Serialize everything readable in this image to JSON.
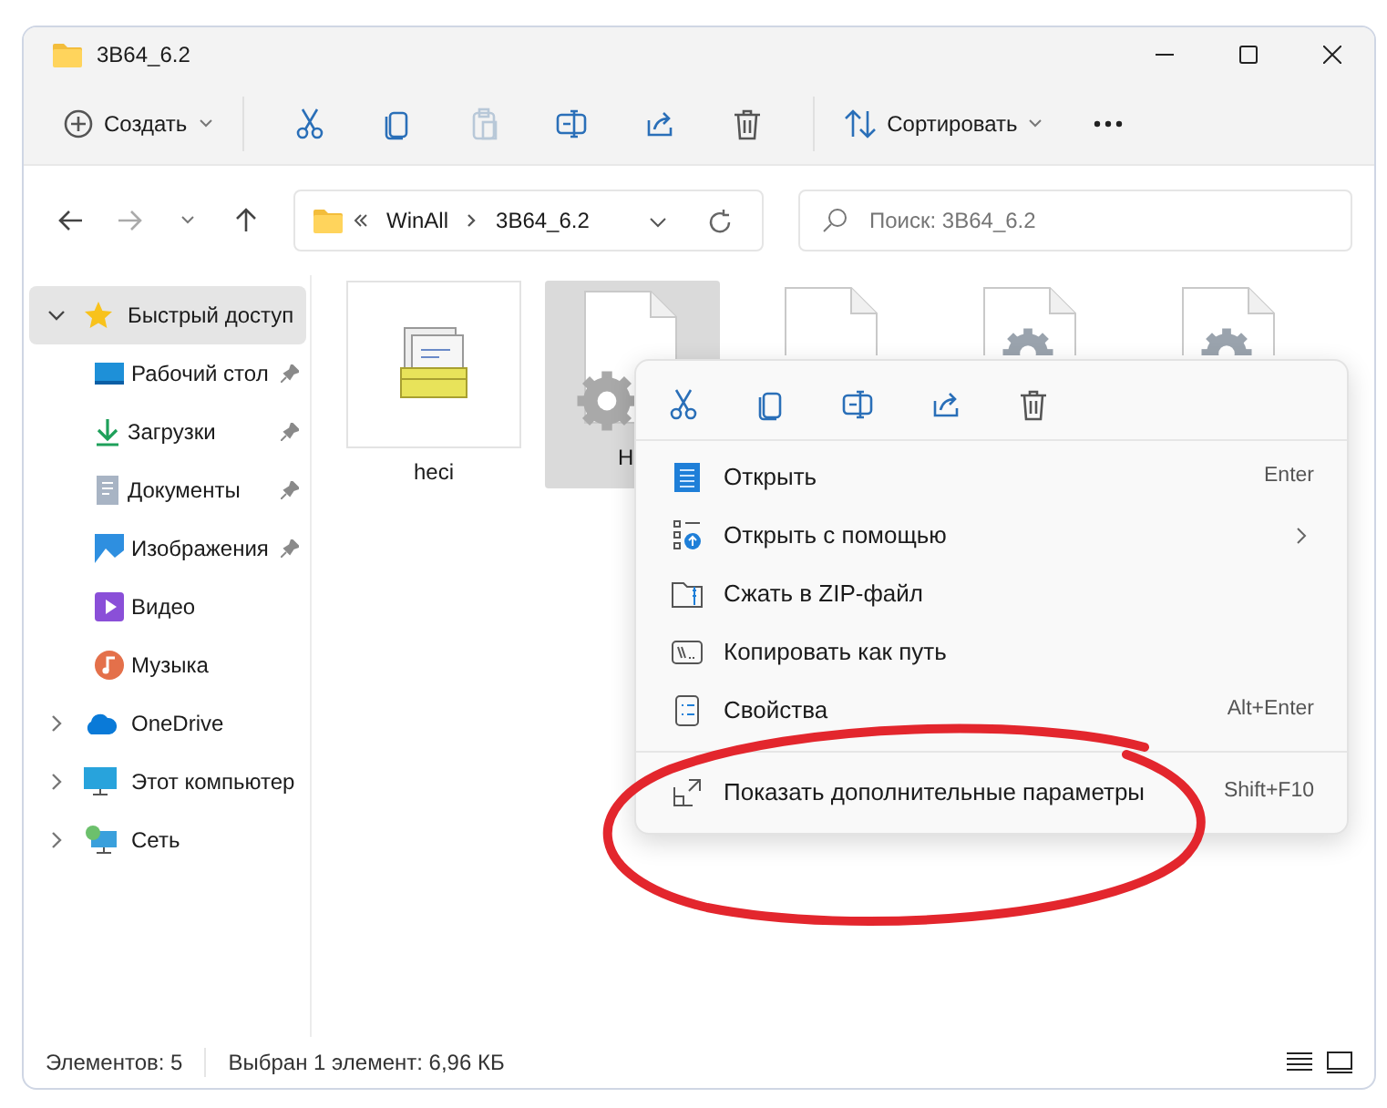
{
  "window": {
    "title": "3B64_6.2"
  },
  "toolbar": {
    "create": {
      "label": "Создать"
    },
    "actions": [
      {
        "kind": "cut",
        "disabled": false
      },
      {
        "kind": "copy",
        "disabled": false
      },
      {
        "kind": "paste",
        "disabled": true
      },
      {
        "kind": "rename",
        "disabled": false
      },
      {
        "kind": "share",
        "disabled": false
      },
      {
        "kind": "delete",
        "disabled": false
      }
    ],
    "sort": {
      "label": "Сортировать"
    }
  },
  "address": {
    "path": [
      "WinAll",
      "3B64_6.2"
    ]
  },
  "search": {
    "placeholder": "Поиск: 3B64_6.2"
  },
  "sidebar": {
    "items": [
      {
        "kind": "star",
        "label": "Быстрый доступ",
        "expanded": true,
        "selected": true,
        "children": [
          {
            "kind": "desktop",
            "label": "Рабочий стол",
            "pinned": true,
            "selected": false
          },
          {
            "kind": "downloads",
            "label": "Загрузки",
            "pinned": true,
            "selected": false
          },
          {
            "kind": "documents",
            "label": "Документы",
            "pinned": true,
            "selected": false
          },
          {
            "kind": "pictures",
            "label": "Изображения",
            "pinned": true,
            "selected": false
          },
          {
            "kind": "video",
            "label": "Видео",
            "pinned": false,
            "selected": false
          },
          {
            "kind": "music",
            "label": "Музыка",
            "pinned": false,
            "selected": false
          }
        ]
      },
      {
        "kind": "cloud",
        "label": "OneDrive",
        "expanded": false,
        "selected": false
      },
      {
        "kind": "computer",
        "label": "Этот компьютер",
        "expanded": false,
        "selected": false
      },
      {
        "kind": "network",
        "label": "Сеть",
        "expanded": false,
        "selected": false
      }
    ]
  },
  "files": [
    {
      "kind": "archive",
      "name": "heci",
      "selected": false
    },
    {
      "kind": "gear",
      "name": "H",
      "selected": true
    },
    {
      "kind": "blank",
      "selected": false
    },
    {
      "kind": "gearpage",
      "selected": false
    },
    {
      "kind": "gearpage",
      "selected": false
    }
  ],
  "context_menu": {
    "actions": [
      {
        "kind": "cut"
      },
      {
        "kind": "copy"
      },
      {
        "kind": "rename"
      },
      {
        "kind": "share"
      },
      {
        "kind": "delete"
      }
    ],
    "items": [
      {
        "kind": "open",
        "label": "Открыть",
        "shortcut": "Enter"
      },
      {
        "kind": "openwith",
        "label": "Открыть с помощью",
        "submenu": true
      },
      {
        "kind": "zip",
        "label": "Сжать в ZIP-файл"
      },
      {
        "kind": "path",
        "label": "Копировать как путь"
      },
      {
        "kind": "props",
        "label": "Свойства",
        "shortcut": "Alt+Enter"
      },
      {
        "kind": "more",
        "label": "Показать дополнительные параметры",
        "shortcut": "Shift+F10",
        "separated": true
      }
    ]
  },
  "status_bar": {
    "count": "Элементов: 5",
    "selection": "Выбран 1 элемент: 6,96 КБ"
  }
}
